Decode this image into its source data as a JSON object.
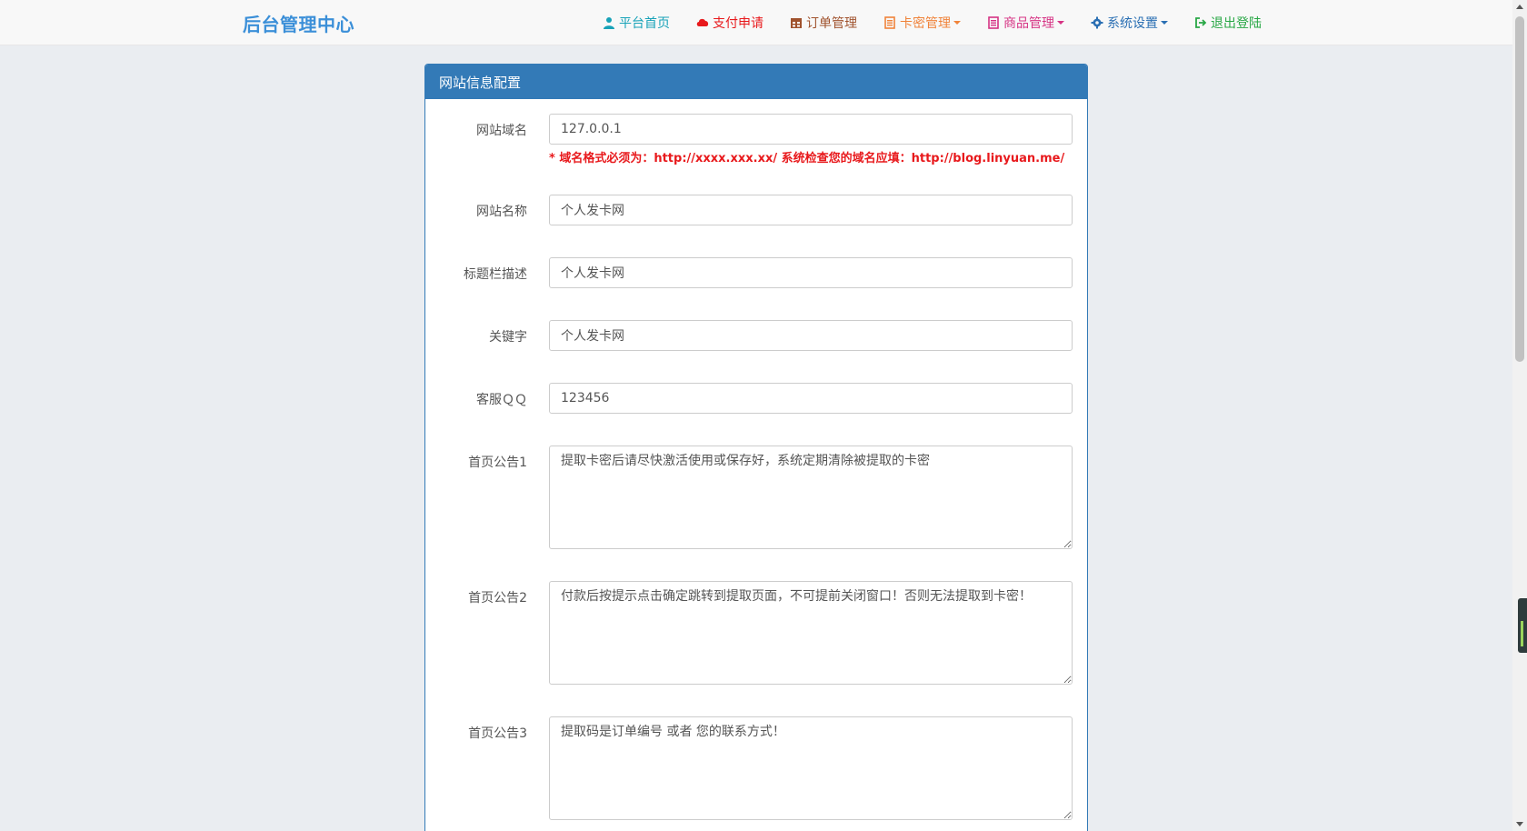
{
  "navbar": {
    "brand": "后台管理中心",
    "items": [
      {
        "label": "平台首页",
        "icon": "user-icon",
        "color": "#17a2b8",
        "caret": false
      },
      {
        "label": "支付申请",
        "icon": "cloud-icon",
        "color": "#e8191c",
        "caret": false
      },
      {
        "label": "订单管理",
        "icon": "calendar-icon",
        "color": "#a0522d",
        "caret": false
      },
      {
        "label": "卡密管理",
        "icon": "list-icon",
        "color": "#f0833a",
        "caret": true
      },
      {
        "label": "商品管理",
        "icon": "book-icon",
        "color": "#d63384",
        "caret": true
      },
      {
        "label": "系统设置",
        "icon": "gear-icon",
        "color": "#2a6fb3",
        "caret": true
      },
      {
        "label": "退出登陆",
        "icon": "logout-icon",
        "color": "#28a745",
        "caret": false
      }
    ]
  },
  "panel": {
    "title": "网站信息配置",
    "fields": {
      "domain": {
        "label": "网站域名",
        "value": "127.0.0.1",
        "help": "* 域名格式必须为：http://xxxx.xxx.xx/ 系统检查您的域名应填：http://blog.linyuan.me/"
      },
      "site_name": {
        "label": "网站名称",
        "value": "个人发卡网"
      },
      "title_desc": {
        "label": "标题栏描述",
        "value": "个人发卡网"
      },
      "keywords": {
        "label": "关键字",
        "value": "个人发卡网"
      },
      "qq": {
        "label": "客服ＱＱ",
        "value": "123456"
      },
      "notice1": {
        "label": "首页公告1",
        "value": "提取卡密后请尽快激活使用或保存好，系统定期清除被提取的卡密"
      },
      "notice2": {
        "label": "首页公告2",
        "value": "付款后按提示点击确定跳转到提取页面，不可提前关闭窗口！否则无法提取到卡密！"
      },
      "notice3": {
        "label": "首页公告3",
        "value": "提取码是订单编号 或者 您的联系方式！"
      }
    }
  }
}
